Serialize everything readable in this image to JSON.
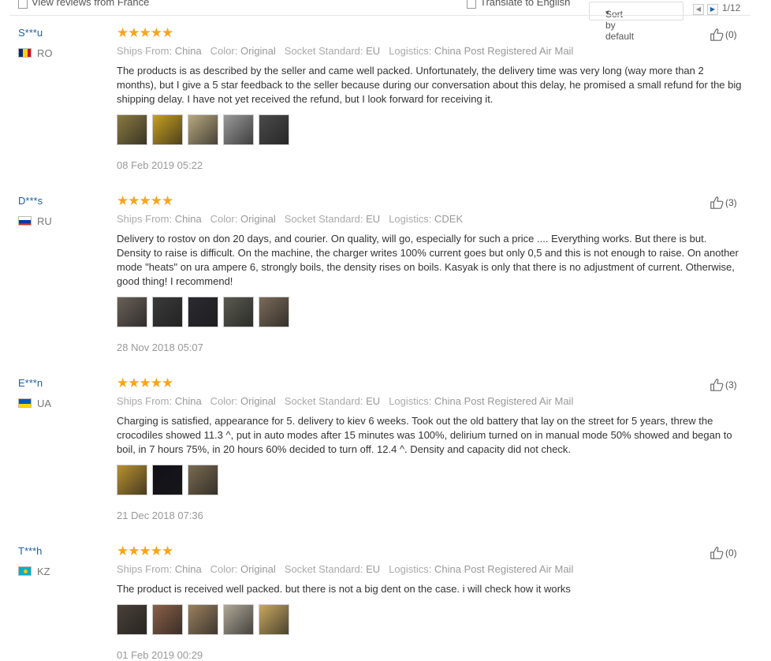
{
  "toolbar": {
    "view_reviews_label": "View reviews from France",
    "translate_label": "Translate to English",
    "sort_label": "Sort by default",
    "sort_caret": "▾",
    "prev_icon": "◀",
    "next_icon": "▶",
    "page_indicator": "1/12"
  },
  "labels": {
    "ships_from": "Ships From:",
    "color": "Color:",
    "socket": "Socket Standard:",
    "logistics": "Logistics:"
  },
  "stars": "★★★★★",
  "reviews": [
    {
      "user": "S***u",
      "country": "RO",
      "flag": "ro",
      "ships_from": "China",
      "color": "Original",
      "socket": "EU",
      "logistics": "China Post Registered Air Mail",
      "text": "The products is as described by the seller and came well packed. Unfortunately, the delivery time was very long (way more than 2 months), but I give a 5 star feedback to the seller because during our conversation about this delay, he promised a small refund for the big shipping delay. I have not yet received the refund, but I look forward for receiving it.",
      "thumbs": [
        "#8a7a40",
        "#c9a020",
        "#b8a880",
        "#9a9a9a",
        "#4a4a4a"
      ],
      "date": "08 Feb 2019 05:22",
      "likes": "(0)"
    },
    {
      "user": "D***s",
      "country": "RU",
      "flag": "ru",
      "ships_from": "China",
      "color": "Original",
      "socket": "EU",
      "logistics": "CDEK",
      "text": "Delivery to rostov on don 20 days, and courier. On quality, will go, especially for such a price .... Everything works. But there is but. Density to raise is difficult. On the machine, the charger writes 100% current goes but only 0,5 and this is not enough to raise. On another mode \"heats\" on ura ampere 6, strongly boils, the density rises on boils. Kasyak is only that there is no adjustment of current. Otherwise, good thing! I recommend!",
      "thumbs": [
        "#6a6058",
        "#3a3a3a",
        "#2a2a30",
        "#5a5a50",
        "#7a6a58"
      ],
      "date": "28 Nov 2018 05:07",
      "likes": "(3)"
    },
    {
      "user": "E***n",
      "country": "UA",
      "flag": "ua",
      "ships_from": "China",
      "color": "Original",
      "socket": "EU",
      "logistics": "China Post Registered Air Mail",
      "text": "Charging is satisfied, appearance for 5. delivery to kiev 6 weeks. Took out the old battery that lay on the street for 5 years, threw the crocodiles showed 11.3 ^, put in auto modes after 15 minutes was 100%, delirium turned on in manual mode 50% showed and began to boil, in 7 hours 75%, in 20 hours 60% decided to turn off. 12.4 ^. Density and capacity did not check.",
      "thumbs": [
        "#b89030",
        "#101018",
        "#7a6a50"
      ],
      "date": "21 Dec 2018 07:36",
      "likes": "(3)"
    },
    {
      "user": "T***h",
      "country": "KZ",
      "flag": "kz",
      "ships_from": "China",
      "color": "Original",
      "socket": "EU",
      "logistics": "China Post Registered Air Mail",
      "text": "The product is received well packed. but there is not a big dent on the case. i will check how it works",
      "thumbs": [
        "#4a4038",
        "#8a6048",
        "#9a8060",
        "#b0a898",
        "#c8a860"
      ],
      "date": "01 Feb 2019 00:29",
      "likes": "(0)"
    }
  ]
}
